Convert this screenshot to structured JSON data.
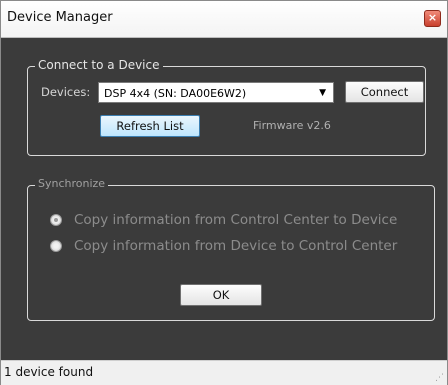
{
  "window": {
    "title": "Device Manager",
    "close_glyph": "×",
    "icon_close": "close-icon"
  },
  "connect_group": {
    "legend": "Connect to a Device",
    "devices_label": "Devices:",
    "device_selected": "DSP 4x4 (SN: DA00E6W2)",
    "connect_label": "Connect",
    "refresh_label": "Refresh List",
    "firmware": "Firmware v2.6"
  },
  "sync_group": {
    "legend": "Synchronize",
    "options": [
      {
        "label": "Copy information from Control Center to Device",
        "checked": true
      },
      {
        "label": "Copy information from Device to Control Center",
        "checked": false
      }
    ],
    "ok_label": "OK"
  },
  "status": {
    "text": "1 device found"
  },
  "colors": {
    "client_bg": "#3b3b3b",
    "group_border": "#d9d9d9"
  }
}
